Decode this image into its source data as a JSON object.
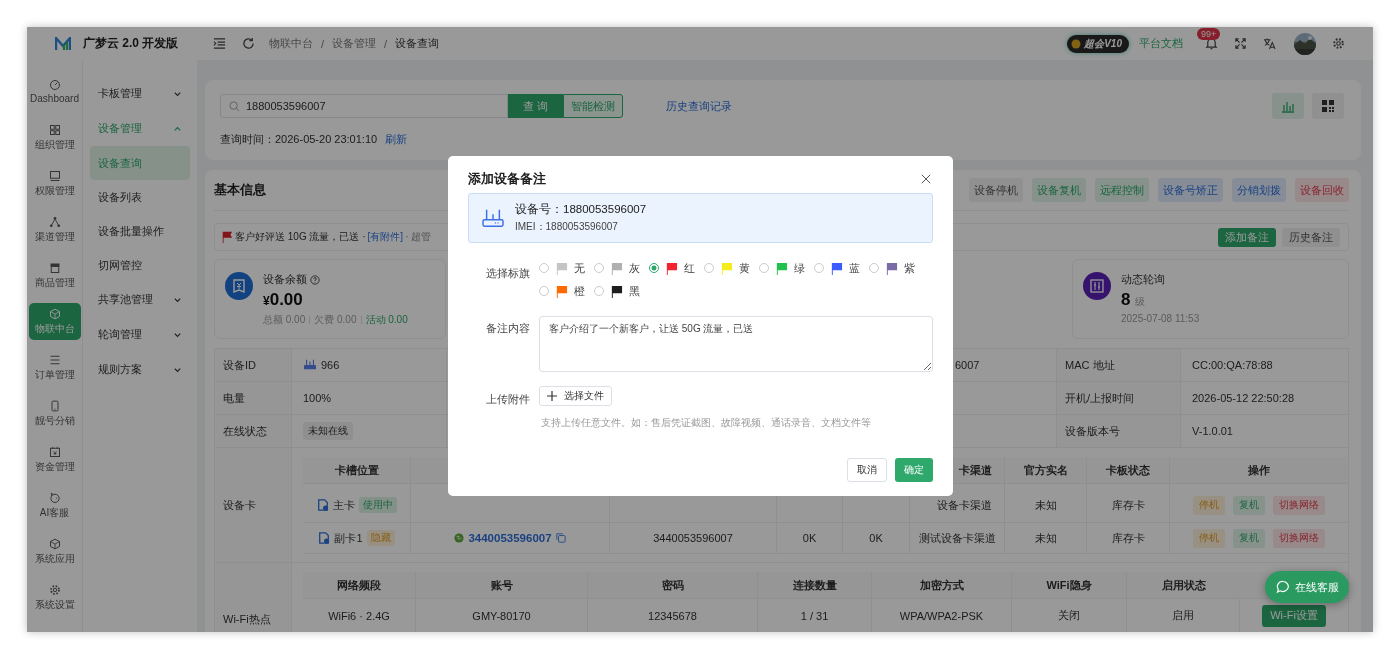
{
  "app": {
    "logo_text": "广梦云 2.0 开发版"
  },
  "breadcrumb": {
    "separator": "/",
    "items": [
      "物联中台",
      "设备管理",
      "设备查询"
    ]
  },
  "header_right": {
    "vip_badge": "超会V10",
    "docs_link": "平台文档",
    "notification_count": "99+"
  },
  "rail": [
    {
      "label": "Dashboard",
      "selected": false
    },
    {
      "label": "组织管理",
      "selected": false
    },
    {
      "label": "权限管理",
      "selected": false
    },
    {
      "label": "渠道管理",
      "selected": false
    },
    {
      "label": "商品管理",
      "selected": false
    },
    {
      "label": "物联中台",
      "selected": true
    },
    {
      "label": "订单管理",
      "selected": false
    },
    {
      "label": "靓号分销",
      "selected": false
    },
    {
      "label": "资金管理",
      "selected": false
    },
    {
      "label": "AI客服",
      "selected": false
    },
    {
      "label": "系统应用",
      "selected": false
    },
    {
      "label": "系统设置",
      "selected": false
    }
  ],
  "subnav": [
    {
      "label": "卡板管理",
      "active": false,
      "expanded": false
    },
    {
      "label": "设备管理",
      "active": true,
      "expanded": true,
      "children": [
        {
          "label": "设备查询",
          "selected": true
        },
        {
          "label": "设备列表",
          "selected": false
        },
        {
          "label": "设备批量操作",
          "selected": false
        },
        {
          "label": "切网管控",
          "selected": false
        }
      ]
    },
    {
      "label": "共享池管理",
      "active": false,
      "expanded": false
    },
    {
      "label": "轮询管理",
      "active": false,
      "expanded": false
    },
    {
      "label": "规则方案",
      "active": false,
      "expanded": false
    }
  ],
  "search": {
    "value": "1880053596007",
    "query_button": "查 询",
    "detect_button": "智能检测",
    "history_link": "历史查询记录",
    "time_label": "查询时间：",
    "time_value": "2026-05-20 23:01:10",
    "refresh_link": "刷新"
  },
  "info": {
    "title": "基本信息",
    "actions": [
      {
        "label": "设备停机",
        "kind": "neutral"
      },
      {
        "label": "设备复机",
        "kind": "success"
      },
      {
        "label": "远程控制",
        "kind": "success"
      },
      {
        "label": "设备号矫正",
        "kind": "info"
      },
      {
        "label": "分销划拨",
        "kind": "info"
      },
      {
        "label": "设备回收",
        "kind": "danger"
      }
    ]
  },
  "note": {
    "text": "客户好评送 10G 流量，已送 ·",
    "attachment": "[有附件]",
    "author": "· 超管",
    "add_button": "添加备注",
    "history_button": "历史备注"
  },
  "balance": {
    "title": "设备余额",
    "currency": "¥",
    "amount": "0.00",
    "total": "总额 0.00",
    "debt": "欠费 0.00",
    "activity": "活动 0.00"
  },
  "polling": {
    "title": "动态轮询",
    "value": "8",
    "unit": "级",
    "time": "2025-07-08 11:53"
  },
  "details": [
    {
      "kind": "device_id",
      "label": "设备ID",
      "value": "966",
      "extra": "6007",
      "label2": "MAC 地址",
      "value2": "CC:00:QA:78:88"
    },
    {
      "kind": "text",
      "label": "电量",
      "value": "100%",
      "label2": "开机/上报时间",
      "value2": "2026-05-12 22:50:28"
    },
    {
      "kind": "tag",
      "label": "在线状态",
      "value": "未知在线",
      "label2": "设备版本号",
      "value2": "V-1.0.01"
    }
  ],
  "cards": {
    "label": "设备卡",
    "columns": {
      "slot": "卡槽位置",
      "channel": "卡渠道",
      "realname": "官方实名",
      "status": "卡板状态",
      "actions": "操作"
    },
    "rows": [
      {
        "slot": "主卡",
        "tag": {
          "label": "使用中",
          "kind": "active"
        },
        "channel": "设备卡渠道",
        "realname": "未知",
        "status": "库存卡",
        "actions": [
          {
            "label": "停机",
            "kind": "warning"
          },
          {
            "label": "复机",
            "kind": "success"
          },
          {
            "label": "切换网络",
            "kind": "danger"
          }
        ]
      },
      {
        "slot": "副卡1",
        "tag": {
          "label": "隐藏",
          "kind": "hidden"
        },
        "number": "3440053596007",
        "iccid": "3440053596007",
        "used": "0K",
        "total": "0K",
        "channel": "测试设备卡渠道",
        "realname": "未知",
        "status": "库存卡",
        "actions": [
          {
            "label": "停机",
            "kind": "warning"
          },
          {
            "label": "复机",
            "kind": "success"
          },
          {
            "label": "切换网络",
            "kind": "danger"
          }
        ]
      }
    ]
  },
  "wifi": {
    "label": "Wi-Fi热点",
    "columns": [
      "网络频段",
      "账号",
      "密码",
      "连接数量",
      "加密方式",
      "WiFi隐身",
      "启用状态"
    ],
    "rows": [
      {
        "cells": [
          "WiFi6 · 2.4G",
          "GMY-80170",
          "12345678",
          "1 / 31",
          "WPA/WPA2-PSK",
          "关闭",
          "启用"
        ],
        "button": "Wi-Fi设置"
      }
    ]
  },
  "chat_button": "在线客服",
  "modal": {
    "title": "添加设备备注",
    "device_label": "设备号：",
    "device_number": "1880053596007",
    "imei": "IMEI：1880053596007",
    "flag_label": "选择标旗",
    "flags": [
      {
        "label": "无",
        "color": "#c4c4c4",
        "selected": false
      },
      {
        "label": "灰",
        "color": "#b0b0b0",
        "selected": false
      },
      {
        "label": "红",
        "color": "#f0232e",
        "selected": true
      },
      {
        "label": "黄",
        "color": "#f4ec1c",
        "selected": false
      },
      {
        "label": "绿",
        "color": "#22c04c",
        "selected": false
      },
      {
        "label": "蓝",
        "color": "#3a5bff",
        "selected": false
      },
      {
        "label": "紫",
        "color": "#7a6aa6",
        "selected": false
      },
      {
        "label": "橙",
        "color": "#ff6a00",
        "selected": false
      },
      {
        "label": "黑",
        "color": "#1e1e1e",
        "selected": false
      }
    ],
    "content_label": "备注内容",
    "content": "客户介绍了一个新客户，让送 50G 流量，已送",
    "upload_label": "上传附件",
    "upload_button": "选择文件",
    "upload_hint": "支持上传任意文件。如：售后凭证截图、故障视频、通话录音、文档文件等",
    "cancel": "取消",
    "confirm": "确定"
  }
}
